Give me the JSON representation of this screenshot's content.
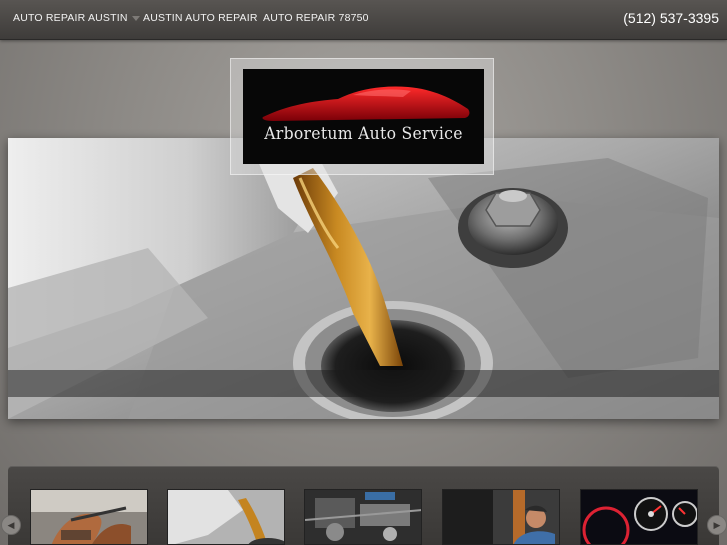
{
  "nav": {
    "items": [
      {
        "label": "AUTO REPAIR AUSTIN",
        "has_dropdown": true
      },
      {
        "label": "AUSTIN AUTO REPAIR",
        "has_dropdown": false
      },
      {
        "label": "AUTO REPAIR 78750",
        "has_dropdown": false
      }
    ],
    "phone": "(512) 537-3395"
  },
  "logo": {
    "text": "Arboretum Auto Service",
    "accent_color": "#c8101c"
  },
  "hero": {
    "image": "oil-pouring-into-engine-photo"
  },
  "thumbnails": [
    {
      "image": "mechanic-hands-photo"
    },
    {
      "image": "oil-pour-photo"
    },
    {
      "image": "engine-bay-photo"
    },
    {
      "image": "mechanic-working-photo"
    },
    {
      "image": "dashboard-gauges-photo"
    }
  ],
  "carousel": {
    "prev_icon": "chevron-left-icon",
    "next_icon": "chevron-right-icon"
  },
  "colors": {
    "topbar": "#4a4846",
    "background": "#8e8b87",
    "strip": "#423f3d"
  }
}
